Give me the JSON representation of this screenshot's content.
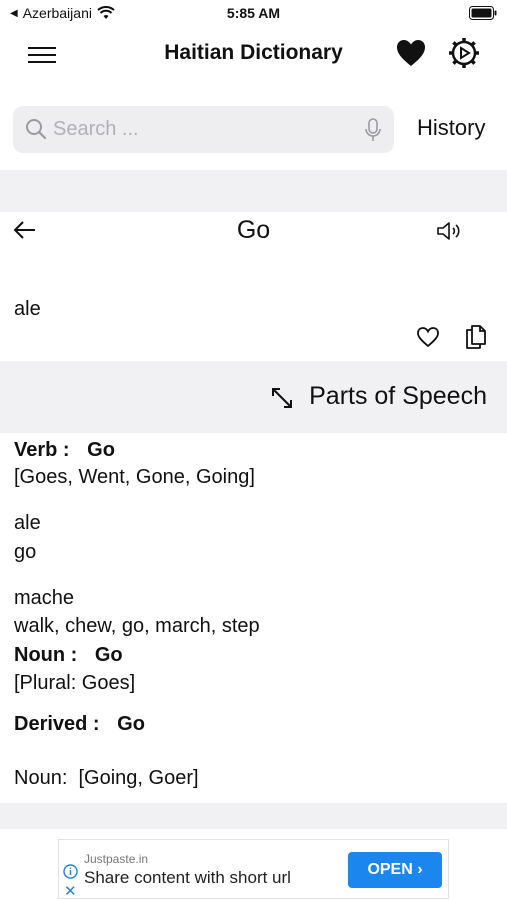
{
  "status_bar": {
    "carrier": "Azerbaijani",
    "time": "5:85 AM"
  },
  "app_bar": {
    "title": "Haitian Dictionary"
  },
  "search": {
    "placeholder": "Search ...",
    "history_label": "History"
  },
  "entry": {
    "word": "Go",
    "translation": "ale"
  },
  "parts_of_speech": {
    "header": "Parts of Speech",
    "verb": {
      "label": "Verb :",
      "word": "Go",
      "forms": "[Goes, Went, Gone, Going]",
      "senses": [
        {
          "haitian": "ale",
          "english": "go"
        },
        {
          "haitian": "mache",
          "english": "walk, chew, go, march, step"
        }
      ]
    },
    "noun": {
      "label": "Noun :",
      "word": "Go",
      "forms": "[Plural: Goes]"
    },
    "derived": {
      "label": "Derived :",
      "word": "Go",
      "items": "Noun:  [Going, Goer]"
    }
  },
  "ad": {
    "source": "Justpaste.in",
    "text": "Share content with short url",
    "cta": "OPEN ›"
  },
  "colors": {
    "accent": "#1a86ee",
    "band": "#f1f1f3",
    "search_bg": "#eeeef1"
  }
}
